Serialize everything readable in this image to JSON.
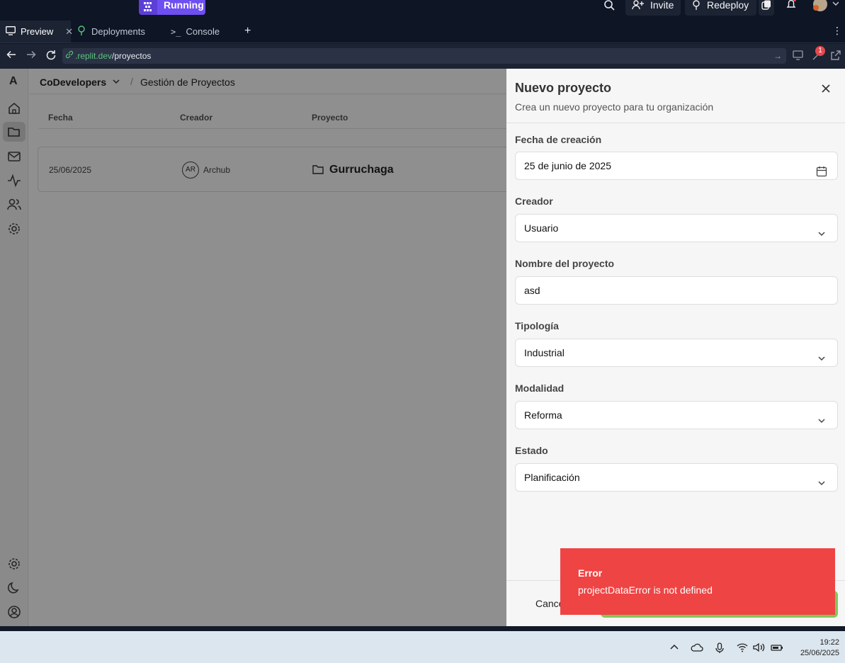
{
  "replit": {
    "run_label": "Running",
    "invite_label": "Invite",
    "redeploy_label": "Redeploy"
  },
  "tabs": [
    {
      "label": "Preview",
      "icon": "monitor-icon"
    },
    {
      "label": "Deployments",
      "icon": "deploy-icon"
    },
    {
      "label": "Console",
      "icon": "terminal-icon"
    }
  ],
  "url": {
    "host": ".replit.dev",
    "path": "/proyectos",
    "notification_count": "1"
  },
  "app": {
    "logo": "A",
    "org_name": "CoDevelopers",
    "breadcrumb_sep": "/",
    "page_title": "Gestión de Proyectos",
    "table": {
      "columns": [
        "Fecha",
        "Creador",
        "Proyecto"
      ],
      "rows": [
        {
          "fecha": "25/06/2025",
          "avatar": "AR",
          "creador": "Archub",
          "proyecto": "Gurruchaga"
        }
      ]
    }
  },
  "sheet": {
    "title": "Nuevo proyecto",
    "subtitle": "Crea un nuevo proyecto para tu organización",
    "fields": [
      {
        "label": "Fecha de creación",
        "value": "25 de junio de 2025",
        "icon": "calendar-icon"
      },
      {
        "label": "Creador",
        "value": "Usuario",
        "icon": "chevron-down-icon"
      },
      {
        "label": "Nombre del proyecto",
        "value": "asd",
        "icon": ""
      },
      {
        "label": "Tipología",
        "value": "Industrial",
        "icon": "chevron-down-icon"
      },
      {
        "label": "Modalidad",
        "value": "Reforma",
        "icon": "chevron-down-icon"
      },
      {
        "label": "Estado",
        "value": "Planificación",
        "icon": "chevron-down-icon"
      }
    ],
    "cancel_label": "Cance"
  },
  "toast": {
    "title": "Error",
    "message": "projectDataError is not defined",
    "color": "#ef4444"
  },
  "taskbar": {
    "time": "19:22",
    "date": "25/06/2025"
  }
}
